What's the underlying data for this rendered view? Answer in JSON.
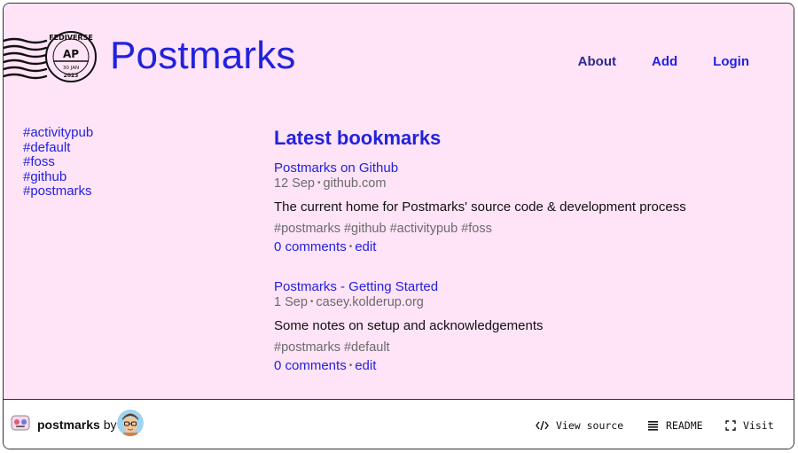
{
  "header": {
    "title": "Postmarks",
    "stamp_text": {
      "top": "FEDIVERSE",
      "middle": "AP",
      "date": "30 JAN",
      "year": "2023"
    },
    "nav": [
      {
        "label": "About"
      },
      {
        "label": "Add"
      },
      {
        "label": "Login"
      }
    ]
  },
  "sidebar": {
    "tags": [
      "#activitypub",
      "#default",
      "#foss",
      "#github",
      "#postmarks"
    ]
  },
  "main": {
    "heading": "Latest bookmarks",
    "bookmarks": [
      {
        "title": "Postmarks on Github",
        "date": "12 Sep",
        "domain": "github.com",
        "description": "The current home for Postmarks' source code & development process",
        "tags": "#postmarks #github #activitypub #foss",
        "comments": "0 comments",
        "edit": "edit"
      },
      {
        "title": "Postmarks - Getting Started",
        "date": "1 Sep",
        "domain": "casey.kolderup.org",
        "description": "Some notes on setup and acknowledgements",
        "tags": "#postmarks #default",
        "comments": "0 comments",
        "edit": "edit"
      }
    ]
  },
  "footer": {
    "brand": "postmarks",
    "by": "by",
    "links": [
      {
        "label": "View source",
        "icon": "code-icon"
      },
      {
        "label": "README",
        "icon": "list-icon"
      },
      {
        "label": "Visit",
        "icon": "fullscreen-icon"
      }
    ]
  },
  "colors": {
    "background": "#ffe3f6",
    "accent": "#2222dd",
    "nav_about": "#2c2c8c",
    "muted": "#6b6b6b"
  }
}
